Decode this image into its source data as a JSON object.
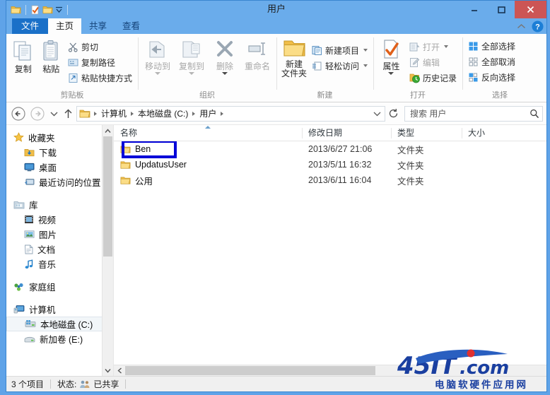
{
  "window": {
    "title": "用户",
    "quick_access": [
      "folder-icon",
      "properties-icon",
      "new-folder-icon",
      "customize-caret-icon"
    ],
    "controls": {
      "minimize": "minimize-icon",
      "maximize": "maximize-icon",
      "close": "close-icon"
    }
  },
  "tabs": [
    {
      "label": "文件",
      "name": "tab-file"
    },
    {
      "label": "主页",
      "name": "tab-home"
    },
    {
      "label": "共享",
      "name": "tab-share"
    },
    {
      "label": "查看",
      "name": "tab-view"
    }
  ],
  "ribbon": {
    "collapse_icon": "chevron-up-icon",
    "help_icon": "help-icon",
    "groups": [
      {
        "label": "剪贴板",
        "big": [
          {
            "label": "复制",
            "icon": "copy-icon"
          },
          {
            "label": "粘贴",
            "icon": "paste-icon"
          }
        ],
        "small": [
          {
            "label": "剪切",
            "icon": "scissors-icon"
          },
          {
            "label": "复制路径",
            "icon": "copy-path-icon"
          },
          {
            "label": "粘贴快捷方式",
            "icon": "paste-shortcut-icon"
          }
        ]
      },
      {
        "label": "组织",
        "big": [
          {
            "label": "移动到",
            "icon": "move-to-icon"
          },
          {
            "label": "复制到",
            "icon": "copy-to-icon"
          },
          {
            "label": "删除",
            "icon": "delete-icon"
          },
          {
            "label": "重命名",
            "icon": "rename-icon"
          }
        ],
        "small": []
      },
      {
        "label": "新建",
        "big": [
          {
            "label": "新建\n文件夹",
            "label_line1": "新建",
            "label_line2": "文件夹",
            "icon": "new-folder-icon"
          }
        ],
        "small": [
          {
            "label": "新建项目",
            "icon": "new-item-icon"
          },
          {
            "label": "轻松访问",
            "icon": "easy-access-icon"
          }
        ]
      },
      {
        "label": "打开",
        "big": [
          {
            "label": "属性",
            "icon": "properties-icon"
          }
        ],
        "small": [
          {
            "label": "打开",
            "icon": "open-icon"
          },
          {
            "label": "编辑",
            "icon": "edit-icon"
          },
          {
            "label": "历史记录",
            "icon": "history-icon"
          }
        ]
      },
      {
        "label": "选择",
        "big": [],
        "small": [
          {
            "label": "全部选择",
            "icon": "select-all-icon"
          },
          {
            "label": "全部取消",
            "icon": "select-none-icon"
          },
          {
            "label": "反向选择",
            "icon": "invert-selection-icon"
          }
        ]
      }
    ]
  },
  "addressbar": {
    "back_icon": "back-arrow-icon",
    "forward_icon": "forward-arrow-icon",
    "recent_icon": "recent-locations-caret-icon",
    "up_icon": "up-arrow-icon",
    "folder_icon": "folder-icon",
    "crumbs": [
      "计算机",
      "本地磁盘 (C:)",
      "用户"
    ],
    "dropdown_icon": "chevron-down-icon",
    "refresh_icon": "refresh-icon",
    "search_placeholder": "搜索 用户",
    "search_icon": "search-icon"
  },
  "navpane": {
    "items": [
      {
        "label": "收藏夹",
        "icon": "star-icon",
        "level": 1
      },
      {
        "label": "下载",
        "icon": "downloads-icon",
        "level": 2
      },
      {
        "label": "桌面",
        "icon": "desktop-icon",
        "level": 2
      },
      {
        "label": "最近访问的位置",
        "icon": "recent-places-icon",
        "level": 2
      },
      {
        "label": "库",
        "icon": "libraries-icon",
        "level": 1,
        "gap_before": true
      },
      {
        "label": "视频",
        "icon": "video-icon",
        "level": 2
      },
      {
        "label": "图片",
        "icon": "pictures-icon",
        "level": 2
      },
      {
        "label": "文档",
        "icon": "documents-icon",
        "level": 2
      },
      {
        "label": "音乐",
        "icon": "music-icon",
        "level": 2
      },
      {
        "label": "家庭组",
        "icon": "homegroup-icon",
        "level": 1,
        "gap_before": true
      },
      {
        "label": "计算机",
        "icon": "computer-icon",
        "level": 1,
        "gap_before": true
      },
      {
        "label": "本地磁盘 (C:)",
        "icon": "harddisk-icon",
        "level": 2,
        "selected": true
      },
      {
        "label": "新加卷 (E:)",
        "icon": "drive-icon",
        "level": 2
      }
    ]
  },
  "filelist": {
    "columns": [
      {
        "label": "名称",
        "sorted": true
      },
      {
        "label": "修改日期",
        "sorted": false
      },
      {
        "label": "类型",
        "sorted": false
      },
      {
        "label": "大小",
        "sorted": false
      }
    ],
    "rows": [
      {
        "name": "Ben",
        "date": "2013/6/27 21:06",
        "type": "文件夹",
        "size": "",
        "icon": "folder-icon",
        "annotated": true
      },
      {
        "name": "UpdatusUser",
        "date": "2013/5/11 16:32",
        "type": "文件夹",
        "size": "",
        "icon": "folder-icon"
      },
      {
        "name": "公用",
        "date": "2013/6/11 16:04",
        "type": "文件夹",
        "size": "",
        "icon": "folder-icon"
      }
    ]
  },
  "statusbar": {
    "item_count": "3 个项目",
    "status_label": "状态:",
    "status_value": "已共享",
    "status_icon": "shared-users-icon"
  },
  "watermark": {
    "main": "45IT.com",
    "sub": "电脑软硬件应用网"
  },
  "colors": {
    "titlebar": "#6aaceb",
    "file_tab": "#1a70c8",
    "close_button": "#cc5555",
    "annotation": "#0000d8",
    "watermark_blue": "#1a3fa0"
  }
}
